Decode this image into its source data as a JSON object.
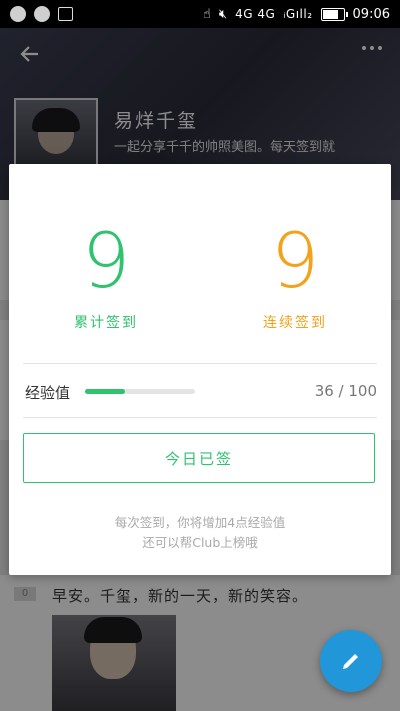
{
  "status_bar": {
    "network": "4G 4G",
    "signal": "ᵢGıll₂",
    "time": "09:06"
  },
  "header": {
    "back_icon": "arrow-left-icon",
    "more_icon": "more-dots-icon"
  },
  "club": {
    "name": "易烊千玺",
    "description": "一起分享千千的帅照美图。每天签到就"
  },
  "dialog": {
    "total_checkins": {
      "value": "9",
      "label": "累计签到",
      "color": "#2fc26f"
    },
    "streak_checkins": {
      "value": "9",
      "label": "连续签到",
      "color": "#f2a21b"
    },
    "experience": {
      "label": "经验值",
      "current": 36,
      "max": 100,
      "display": "36 / 100"
    },
    "checkin_button": "今日已签",
    "hint_line1": "每次签到，你将增加4点经验值",
    "hint_line2": "还可以帮Club上榜哦"
  },
  "post": {
    "floor": "0",
    "text": "早安。千玺，新的一天，新的笑容。"
  },
  "fab": {
    "icon": "pencil-icon",
    "color": "#2196d8"
  }
}
